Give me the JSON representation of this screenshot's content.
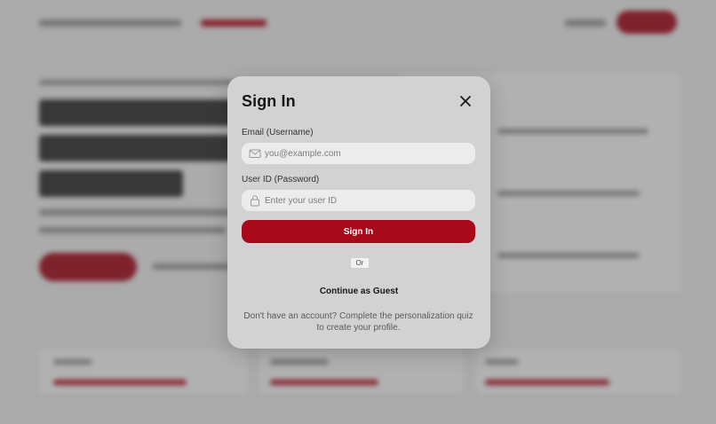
{
  "colors": {
    "brand_red": "#a7091a",
    "modal_bg": "#d2d2d2",
    "input_bg": "#ececec"
  },
  "modal": {
    "title": "Sign In",
    "close_icon": "close-icon",
    "email": {
      "label": "Email (Username)",
      "placeholder": "you@example.com",
      "value": "",
      "icon": "mail-icon"
    },
    "password": {
      "label": "User ID (Password)",
      "placeholder": "Enter your user ID",
      "value": "",
      "icon": "lock-icon"
    },
    "sign_in_label": "Sign In",
    "divider_label": "Or",
    "guest_label": "Continue as Guest",
    "footer_text": "Don't have an account? Complete the personalization quiz to create your profile."
  }
}
